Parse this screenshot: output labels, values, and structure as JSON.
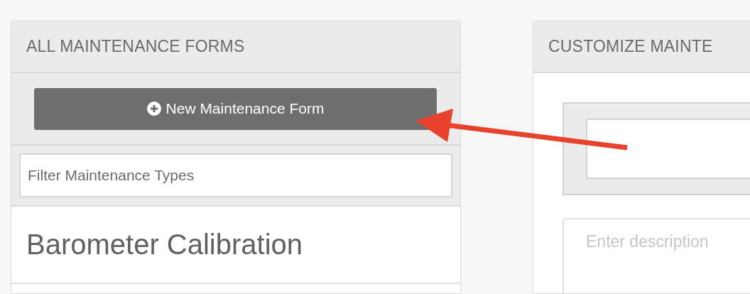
{
  "left_panel": {
    "title": "ALL MAINTENANCE FORMS",
    "new_button": {
      "label": "New Maintenance Form"
    },
    "filter": {
      "placeholder": "Filter Maintenance Types"
    },
    "items": [
      {
        "label": "Barometer Calibration"
      }
    ]
  },
  "right_panel": {
    "title": "CUSTOMIZE MAINTE",
    "description": {
      "placeholder": "Enter description"
    }
  }
}
